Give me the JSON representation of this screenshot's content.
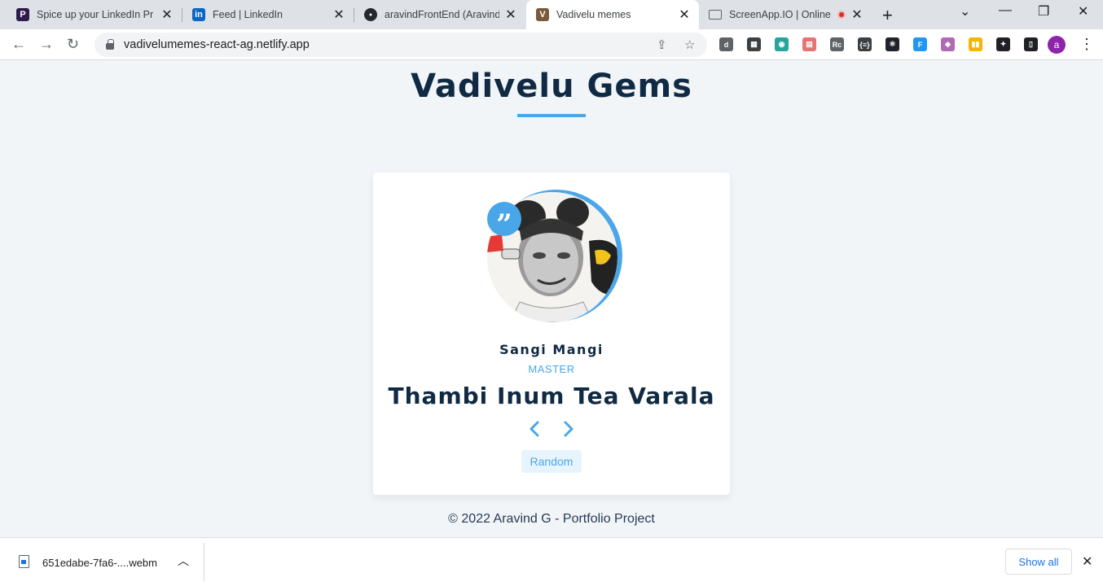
{
  "browser": {
    "tabs": [
      {
        "title": "Spice up your LinkedIn Pr",
        "favicon_label": "P",
        "favicon_color": "#2d1b4e",
        "active": false
      },
      {
        "title": "Feed | LinkedIn",
        "favicon_label": "in",
        "favicon_color": "#0a66c2",
        "active": false
      },
      {
        "title": "aravindFrontEnd (Aravind",
        "favicon_label": "GH",
        "favicon_color": "#24292f",
        "active": false
      },
      {
        "title": "Vadivelu memes",
        "favicon_label": "V",
        "favicon_color": "#7a5a3a",
        "active": true
      },
      {
        "title": "ScreenApp.IO | Online",
        "favicon_label": "monitor-icon",
        "favicon_color": "#5f6368",
        "active": false
      }
    ],
    "url": "vadivelumemes-react-ag.netlify.app",
    "profile_initial": "a",
    "extensions": [
      {
        "name": "extension-d-icon",
        "label": "d",
        "color": "#5f6368"
      },
      {
        "name": "extension-grid-icon",
        "label": "▦",
        "color": "#3c4043"
      },
      {
        "name": "extension-eye-icon",
        "label": "◉",
        "color": "#26a69a"
      },
      {
        "name": "extension-calendar-icon",
        "label": "▤",
        "color": "#e57373"
      },
      {
        "name": "extension-rc-icon",
        "label": "Rc",
        "color": "#5f6368"
      },
      {
        "name": "extension-json-icon",
        "label": "{≡}",
        "color": "#3c4043"
      },
      {
        "name": "extension-react-icon",
        "label": "⚛",
        "color": "#20232a"
      },
      {
        "name": "extension-f-icon",
        "label": "F",
        "color": "#2196f3"
      },
      {
        "name": "extension-gradient-icon",
        "label": "◆",
        "color": "#b06ab3"
      },
      {
        "name": "extension-bars-icon",
        "label": "▮▮",
        "color": "#f4b400"
      },
      {
        "name": "extensions-puzzle-icon",
        "label": "✦",
        "color": "#202124"
      },
      {
        "name": "side-panel-icon",
        "label": "▯",
        "color": "#202124"
      }
    ]
  },
  "page": {
    "title": "Vadivelu Gems",
    "person": {
      "name": "Sangi Mangi",
      "job": "MASTER",
      "quote": "Thambi Inum Tea Varala"
    },
    "random_label": "Random",
    "footer": "© 2022 Aravind G - Portfolio Project"
  },
  "downloads": {
    "file_name": "651edabe-7fa6-....webm",
    "show_all_label": "Show all"
  },
  "colors": {
    "accent": "#49a6e9",
    "heading": "#102a43",
    "background": "#f1f5f8"
  }
}
